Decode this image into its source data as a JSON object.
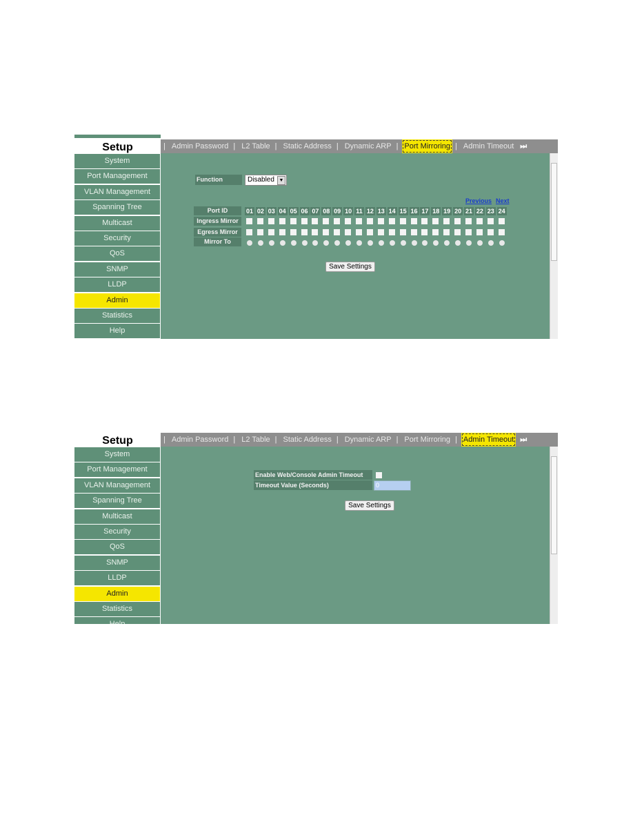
{
  "sidebar": {
    "title": "Setup",
    "items": [
      "System",
      "Port Management",
      "VLAN Management",
      "Spanning Tree",
      "Multicast",
      "Security",
      "QoS",
      "SNMP",
      "LLDP",
      "Admin",
      "Statistics",
      "Help"
    ],
    "active": "Admin"
  },
  "tabs": [
    "Admin Password",
    "L2 Table",
    "Static Address",
    "Dynamic ARP",
    "Port Mirroring",
    "Admin Timeout"
  ],
  "colors": {
    "content_bg": "#6b9a84",
    "sidebar_bg": "#5f9078",
    "active": "#f5e600",
    "tabbar": "#8e8e8e"
  },
  "port_mirroring": {
    "active_tab": "Port Mirroring",
    "function_label": "Function",
    "function_value": "Disabled",
    "previous_label": "Previous",
    "next_label": "Next",
    "row_labels": {
      "port_id": "Port ID",
      "ingress": "Ingress Mirror",
      "egress": "Egress Mirror",
      "mirror_to": "Mirror To"
    },
    "ports": [
      "01",
      "02",
      "03",
      "04",
      "05",
      "06",
      "07",
      "08",
      "09",
      "10",
      "11",
      "12",
      "13",
      "14",
      "15",
      "16",
      "17",
      "18",
      "19",
      "20",
      "21",
      "22",
      "23",
      "24"
    ],
    "save_label": "Save Settings"
  },
  "admin_timeout": {
    "active_tab": "Admin Timeout",
    "enable_label": "Enable Web/Console Admin Timeout",
    "enable_checked": false,
    "timeout_label": "Timeout Value (Seconds)",
    "timeout_value": "0",
    "save_label": "Save Settings"
  }
}
